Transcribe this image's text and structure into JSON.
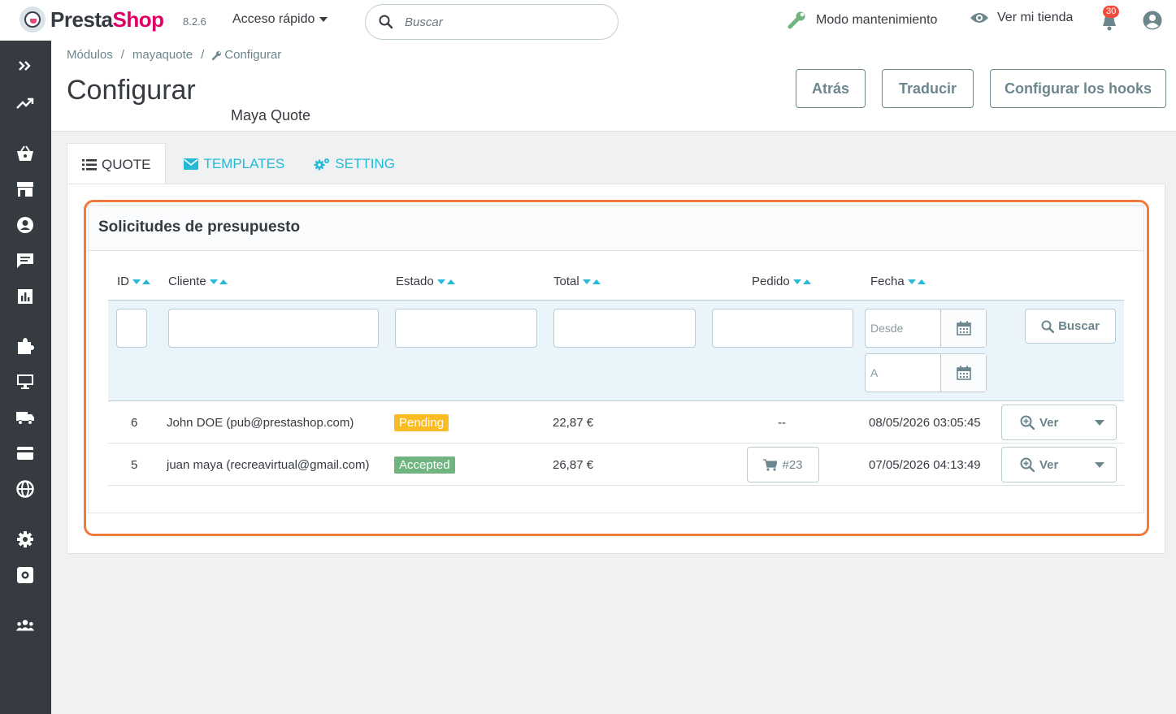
{
  "app": {
    "brand_part1": "Presta",
    "brand_part2": "Shop",
    "version": "8.2.6",
    "quick_access": "Acceso rápido",
    "search_placeholder": "Buscar",
    "maintenance": "Modo mantenimiento",
    "view_store": "Ver mi tienda",
    "notifications": "30"
  },
  "sidebar": {
    "icons": [
      "expand-icon",
      "stats-trend-icon",
      "orders-basket-icon",
      "catalog-store-icon",
      "customers-icon",
      "messages-icon",
      "stats-icon",
      "modules-puzzle-icon",
      "design-monitor-icon",
      "shipping-truck-icon",
      "payment-card-icon",
      "international-globe-icon",
      "settings-gear-icon",
      "advanced-settings-icon",
      "team-icon"
    ]
  },
  "breadcrumb": [
    "Módulos",
    "mayaquote",
    "Configurar"
  ],
  "page": {
    "title": "Configurar",
    "subtitle": "Maya Quote",
    "buttons": {
      "back": "Atrás",
      "translate": "Traducir",
      "hooks": "Configurar los hooks"
    }
  },
  "tabs": [
    {
      "label": "QUOTE",
      "icon": "list-icon",
      "active": true
    },
    {
      "label": "TEMPLATES",
      "icon": "envelope-icon",
      "active": false
    },
    {
      "label": "SETTING",
      "icon": "cogs-icon",
      "active": false
    }
  ],
  "panel": {
    "title": "Solicitudes de presupuesto",
    "columns": [
      "ID",
      "Cliente",
      "Estado",
      "Total",
      "Pedido",
      "Fecha"
    ],
    "filters": {
      "date_from_placeholder": "Desde",
      "date_to_placeholder": "A",
      "search_button": "Buscar"
    },
    "rows": [
      {
        "id": "6",
        "customer": "John DOE (pub@prestashop.com)",
        "status": "Pending",
        "status_color": "#fbbb22",
        "total": "22,87 €",
        "order": "--",
        "has_order_button": false,
        "date": "08/05/2026 03:05:45",
        "action": "Ver"
      },
      {
        "id": "5",
        "customer": "juan maya (recreavirtual@gmail.com)",
        "status": "Accepted",
        "status_color": "#70b580",
        "total": "26,87 €",
        "order": "#23",
        "has_order_button": true,
        "date": "07/05/2026 04:13:49",
        "action": "Ver"
      }
    ]
  },
  "colors": {
    "accent": "#25b9d7",
    "brand": "#df0067",
    "sidebar": "#363a41",
    "highlight": "#f07a3c"
  }
}
